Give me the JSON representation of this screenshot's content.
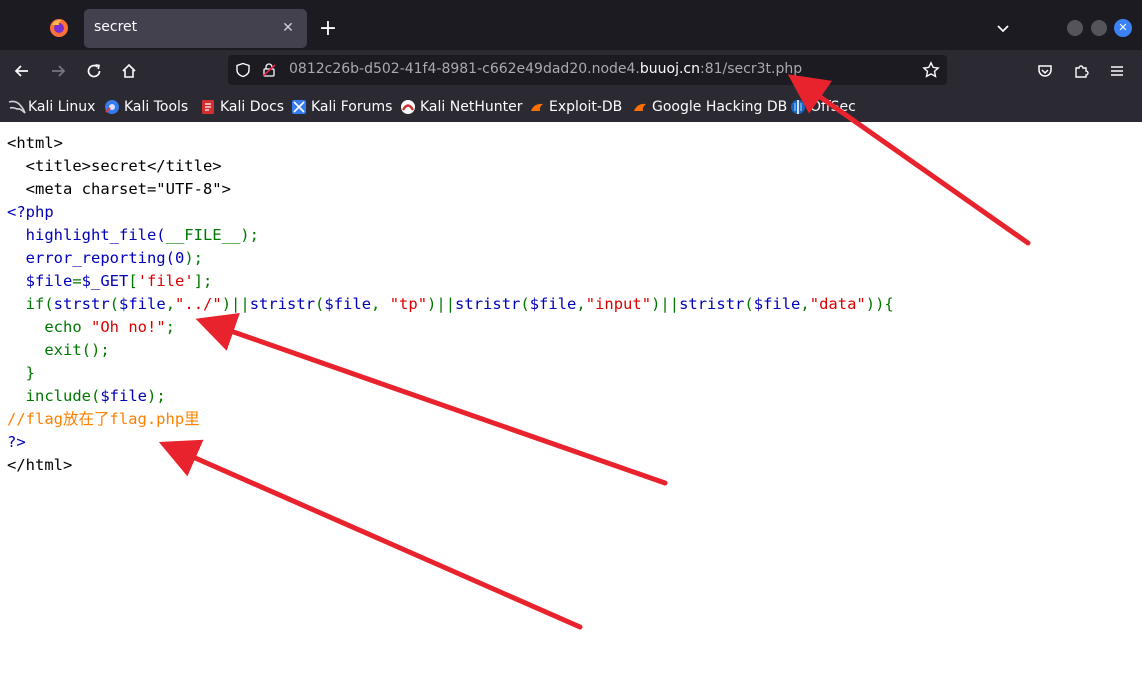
{
  "browser": {
    "tab": {
      "title": "secret"
    },
    "url": {
      "prefix": "0812c26b-d502-41f4-8981-c662e49dad20.node4.",
      "domain": "buuoj.cn",
      "suffix": ":81/secr3t.php"
    },
    "bookmarks": [
      {
        "label": "Kali Linux",
        "icon": "kali-dragon-icon"
      },
      {
        "label": "Kali Tools",
        "icon": "kali-tools-icon"
      },
      {
        "label": "Kali Docs",
        "icon": "kali-docs-icon"
      },
      {
        "label": "Kali Forums",
        "icon": "kali-forums-icon"
      },
      {
        "label": "Kali NetHunter",
        "icon": "nethunter-icon"
      },
      {
        "label": "Exploit-DB",
        "icon": "exploitdb-icon"
      },
      {
        "label": "Google Hacking DB",
        "icon": "ghdb-icon"
      },
      {
        "label": "OffSec",
        "icon": "offsec-icon"
      }
    ]
  },
  "code": {
    "l1": "<html>",
    "l2": "  <title>secret</title>",
    "l3": "  <meta charset=\"UTF-8\">",
    "l4": "<?php",
    "l5a": "  highlight_file(",
    "l5b": "__FILE__",
    "l5c": ");",
    "l6a": "  error_reporting(",
    "l6b": "0",
    "l6c": ");",
    "l7a": "  $file",
    "l7b": "=",
    "l7c": "$_GET",
    "l7d": "[",
    "l7e": "'file'",
    "l7f": "];",
    "l8_kw_if": "  if(",
    "l8_f1": "strstr",
    "l8_p1": "(",
    "l8_v1": "$file",
    "l8_c1": ",",
    "l8_s1": "\"../\"",
    "l8_or1": ")||",
    "l8_f2": "stristr",
    "l8_p2": "(",
    "l8_v2": "$file",
    "l8_c2": ", ",
    "l8_s2": "\"tp\"",
    "l8_or2": ")||",
    "l8_f3": "stristr",
    "l8_p3": "(",
    "l8_v3": "$file",
    "l8_c3": ",",
    "l8_s3": "\"input\"",
    "l8_or3": ")||",
    "l8_f4": "stristr",
    "l8_p4": "(",
    "l8_v4": "$file",
    "l8_c4": ",",
    "l8_s4": "\"data\"",
    "l8_end": ")){",
    "l9a": "    echo ",
    "l9b": "\"Oh no!\"",
    "l9c": ";",
    "l10": "    exit();",
    "l11": "  }",
    "l12a": "  include(",
    "l12b": "$file",
    "l12c": ");",
    "l13": "//flag放在了flag.php里",
    "l14": "?>",
    "l15": "</html>"
  },
  "colors": {
    "default": "#0000bb",
    "keyword": "#007700",
    "string": "#dd0000",
    "comment": "#ff8000",
    "annotation_arrow": "#e8232d"
  }
}
